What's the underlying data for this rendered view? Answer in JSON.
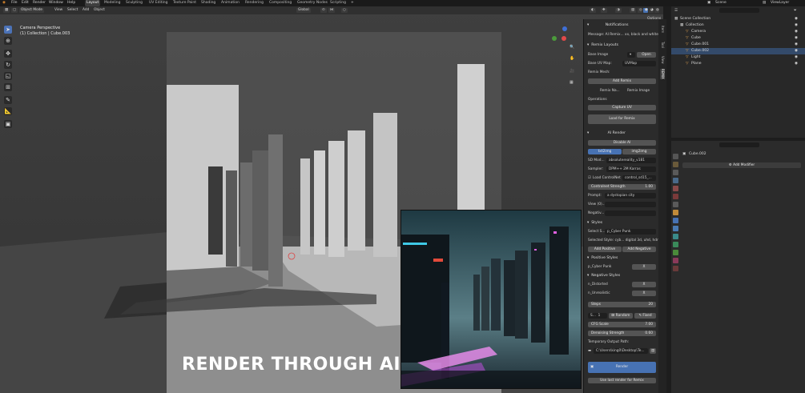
{
  "menu": {
    "items": [
      "File",
      "Edit",
      "Render",
      "Window",
      "Help"
    ],
    "workspaces": [
      "Layout",
      "Modeling",
      "Sculpting",
      "UV Editing",
      "Texture Paint",
      "Shading",
      "Animation",
      "Rendering",
      "Compositing",
      "Geometry Nodes",
      "Scripting"
    ],
    "active_workspace": "Layout",
    "scene": "Scene",
    "view_layer": "ViewLayer"
  },
  "viewport": {
    "mode": "Object Mode",
    "menus": [
      "View",
      "Select",
      "Add",
      "Object"
    ],
    "orientation": "Global",
    "options_label": "Options",
    "overlay_title": "Camera Perspective",
    "overlay_subtitle": "(1) Collection | Cube.003"
  },
  "npanel": {
    "notifications_header": "Notifications",
    "message": "Message: AI Remix... xx, black and white",
    "remix_layouts": "Remix Layouts",
    "base_image_label": "Base Image",
    "open_label": "Open",
    "base_uv_map_label": "Base UV Map:",
    "base_uv_map_value": "UVMap",
    "remix_mesh_label": "Remix Mesh:",
    "add_remix_label": "Add Remix",
    "remix_na": "Remix Na...",
    "remix_image": "Remix Image",
    "operations_label": "Operations",
    "capture_uv_label": "Capture UV",
    "load_for_remix_label": "Load for Remix",
    "ai_render_header": "AI Render",
    "disable_ai_label": "Disable AI",
    "txt2img_label": "txt2img",
    "img2img_label": "img2img",
    "sd_model_label": "SD Mod...",
    "sd_model_value": "absolutereality_v181",
    "sampler_label": "Sampler:",
    "sampler_value": "DPM++ 2M Karras",
    "load_controlnet_label": "Load ControlNet",
    "controlnet_value": "control_sd15_...",
    "controlnet_strength_label": "Controlnet Strength",
    "controlnet_strength_value": "1.00",
    "prompt_label": "Prompt:",
    "prompt_value": "a dystopian city",
    "view_label": "View (0)...",
    "negative_label": "Negativ...",
    "styles_header": "Styles",
    "select_style_label": "Select S...",
    "select_style_value": "p_Cyber Punk",
    "selected_style_text": "Selected Style: cyb... digital 3d, uhd, hdr",
    "add_positive_label": "Add Positive",
    "add_negative_label": "Add Negative",
    "positive_styles_header": "Positive Styles",
    "positive_style_item": "p_Cyber Punk",
    "negative_styles_header": "Negative Styles",
    "negative_style_items": [
      "n_Distorted",
      "n_Unrealistic"
    ],
    "remove_x": "X",
    "steps_label": "Steps",
    "steps_value": "20",
    "seed_label": "S...",
    "seed_value": "1",
    "random_label": "Random",
    "fixed_label": "Fixed",
    "cfg_label": "CFG Scale",
    "cfg_value": "7.00",
    "denoise_label": "Denoising Strength",
    "denoise_value": "0.60",
    "temp_path_label": "Temporary Output Path:",
    "temp_path_value": "C:\\Users\\king0\\Desktop\\Te...",
    "render_label": "Render",
    "use_last_label": "Use last render for Remix"
  },
  "side_tabs": [
    "Item",
    "Tool",
    "View",
    "REMIX"
  ],
  "outliner": {
    "rows": [
      {
        "label": "Scene Collection",
        "indent": 0,
        "color": "#cfcfcf"
      },
      {
        "label": "Collection",
        "indent": 1,
        "color": "#cfcfcf"
      },
      {
        "label": "Camera",
        "indent": 2,
        "color": "#d49a4e"
      },
      {
        "label": "Cube",
        "indent": 2,
        "color": "#d49a4e"
      },
      {
        "label": "Cube.001",
        "indent": 2,
        "color": "#d49a4e"
      },
      {
        "label": "Cube.002",
        "indent": 2,
        "color": "#d49a4e"
      },
      {
        "label": "Light",
        "indent": 2,
        "color": "#d49a4e"
      },
      {
        "label": "Plane",
        "indent": 2,
        "color": "#d49a4e"
      }
    ]
  },
  "properties": {
    "object_name": "Cube.002",
    "add_modifier_label": "Add Modifier"
  },
  "caption": "RENDER THROUGH AI",
  "colors": {
    "accent_blue": "#4772b3",
    "panel": "#2b2b2b",
    "background": "#1d1d1d"
  }
}
